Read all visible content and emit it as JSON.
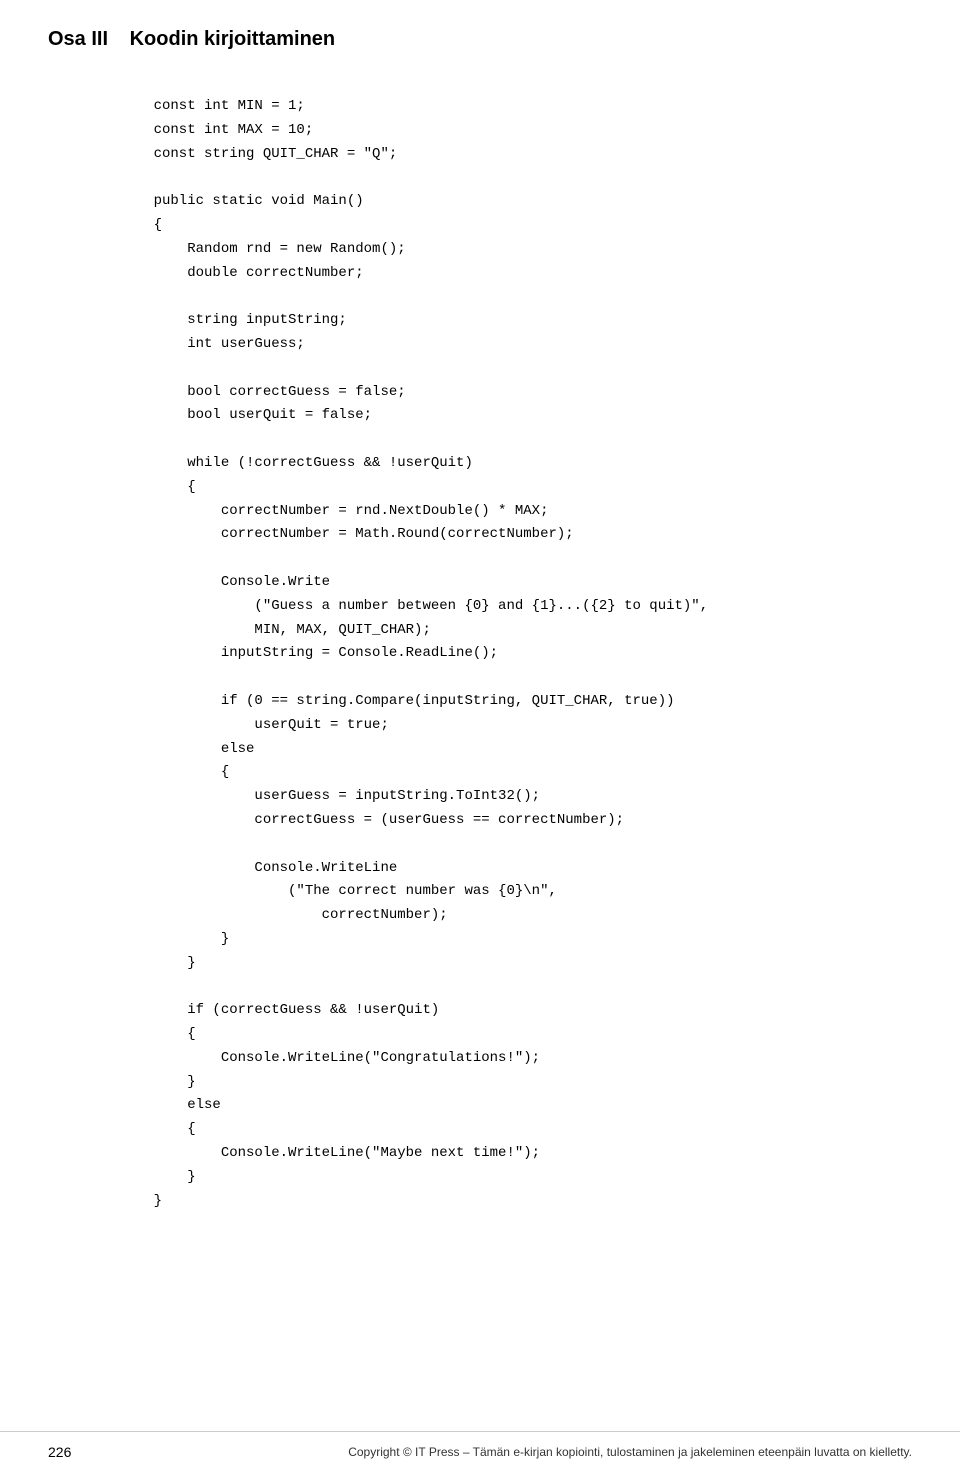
{
  "header": {
    "part": "Osa III",
    "title": "Koodin kirjoittaminen"
  },
  "code": {
    "content": "    const int MIN = 1;\n    const int MAX = 10;\n    const string QUIT_CHAR = \"Q\";\n\n    public static void Main()\n    {\n        Random rnd = new Random();\n        double correctNumber;\n\n        string inputString;\n        int userGuess;\n\n        bool correctGuess = false;\n        bool userQuit = false;\n\n        while (!correctGuess && !userQuit)\n        {\n            correctNumber = rnd.NextDouble() * MAX;\n            correctNumber = Math.Round(correctNumber);\n\n            Console.Write\n                (\"Guess a number between {0} and {1}...({2} to quit)\",\n                MIN, MAX, QUIT_CHAR);\n            inputString = Console.ReadLine();\n\n            if (0 == string.Compare(inputString, QUIT_CHAR, true))\n                userQuit = true;\n            else\n            {\n                userGuess = inputString.ToInt32();\n                correctGuess = (userGuess == correctNumber);\n\n                Console.WriteLine\n                    (\"The correct number was {0}\\n\",\n                        correctNumber);\n            }\n        }\n\n        if (correctGuess && !userQuit)\n        {\n            Console.WriteLine(\"Congratulations!\");\n        }\n        else\n        {\n            Console.WriteLine(\"Maybe next time!\");\n        }\n    }"
  },
  "footer": {
    "page_number": "226",
    "copyright": "Copyright © IT Press – Tämän e-kirjan kopiointi, tulostaminen ja jakeleminen eteenpäin luvatta on kielletty."
  }
}
